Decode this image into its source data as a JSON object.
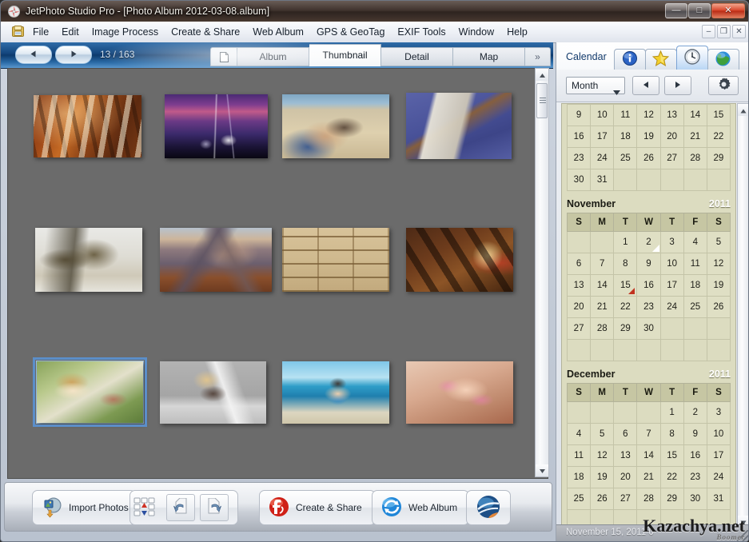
{
  "window": {
    "title": "JetPhoto Studio Pro - [Photo Album 2012-03-08.album]",
    "app_icon": "jetphoto-logo-icon",
    "minimize_label": "—",
    "maximize_label": "□",
    "close_label": "✕"
  },
  "menubar": {
    "doc_icon": "album-document-icon",
    "items": [
      {
        "label": "File"
      },
      {
        "label": "Edit"
      },
      {
        "label": "Image Process"
      },
      {
        "label": "Create & Share"
      },
      {
        "label": "Web Album"
      },
      {
        "label": "GPS & GeoTag"
      },
      {
        "label": "EXIF Tools"
      },
      {
        "label": "Window"
      },
      {
        "label": "Help"
      }
    ],
    "mdi": {
      "minimize": "–",
      "restore": "❐",
      "close": "✕"
    }
  },
  "toolbar": {
    "prev_icon": "triangle-left-icon",
    "next_icon": "triangle-right-icon",
    "counter": "13 / 163",
    "page_icon": "page-icon",
    "tabs": [
      {
        "label": "Album",
        "active": false
      },
      {
        "label": "Thumbnail",
        "active": true
      },
      {
        "label": "Detail",
        "active": false
      },
      {
        "label": "Map",
        "active": false
      }
    ],
    "more_label": "»"
  },
  "photo_grid": {
    "scrollbar": {
      "up_icon": "triangle-up-icon",
      "down_icon": "triangle-down-icon"
    },
    "thumbnails": [
      {
        "name": "wine-bottles",
        "style": "ph-wine",
        "selected": false
      },
      {
        "name": "lightning-storm",
        "style": "ph-storm",
        "selected": false
      },
      {
        "name": "woman-on-beach",
        "style": "ph-beach",
        "selected": false
      },
      {
        "name": "pistol-on-cloth",
        "style": "ph-gun",
        "selected": false
      },
      {
        "name": "soldiers-with-rifle",
        "style": "ph-soldier",
        "selected": false
      },
      {
        "name": "mountain-range",
        "style": "ph-mountain",
        "selected": false
      },
      {
        "name": "wine-corks",
        "style": "ph-cork",
        "selected": false
      },
      {
        "name": "cigars-and-pocket-watch",
        "style": "ph-cigar",
        "selected": false
      },
      {
        "name": "blonde-woman-in-garden",
        "style": "ph-blonde-garden",
        "selected": true
      },
      {
        "name": "blonde-woman-in-boots",
        "style": "ph-blonde-boots",
        "selected": false
      },
      {
        "name": "woman-in-blue-swimsuit",
        "style": "ph-sea",
        "selected": false
      },
      {
        "name": "woman-in-pink-bikini",
        "style": "ph-pink",
        "selected": false
      }
    ]
  },
  "bottom_toolbar": {
    "import_photos": {
      "label": "Import Photos",
      "icon": "import-photos-icon"
    },
    "sort_icon": "sort-updown-icon",
    "undo_icon": "undo-arrow-icon",
    "redo_icon": "redo-arrow-icon",
    "create_share": {
      "label": "Create & Share",
      "icon": "flash-ball-icon"
    },
    "web_album": {
      "label": "Web Album",
      "icon": "web-globe-icon"
    },
    "geotag": {
      "label": "",
      "icon": "geotag-globe-icon"
    }
  },
  "right_panel": {
    "tab_label": "Calendar",
    "tabs": [
      {
        "name": "info-tab",
        "icon": "info-circle-icon",
        "active": false
      },
      {
        "name": "rating-tab",
        "icon": "star-icon",
        "active": false
      },
      {
        "name": "calendar-tab",
        "icon": "clock-icon",
        "active": true
      },
      {
        "name": "map-tab",
        "icon": "globe-icon",
        "active": false
      }
    ],
    "controls": {
      "view_mode": "Month",
      "dropdown_icon": "chevron-down-icon",
      "prev_icon": "triangle-left-icon",
      "next_icon": "triangle-right-icon",
      "settings_icon": "gear-icon"
    },
    "calendar": {
      "weekday_headers": [
        "S",
        "M",
        "T",
        "W",
        "T",
        "F",
        "S"
      ],
      "months": [
        {
          "name": "",
          "year": "",
          "partial": true,
          "weeks": [
            [
              "9",
              "10",
              "11",
              "12",
              "13",
              "14",
              "15"
            ],
            [
              "16",
              "17",
              "18",
              "19",
              "20",
              "21",
              "22"
            ],
            [
              "23",
              "24",
              "25",
              "26",
              "27",
              "28",
              "29"
            ],
            [
              "30",
              "31",
              "",
              "",
              "",
              "",
              ""
            ]
          ]
        },
        {
          "name": "November",
          "year": "2011",
          "partial": false,
          "weeks": [
            [
              "",
              "",
              "1",
              "2",
              "3",
              "4",
              "5"
            ],
            [
              "6",
              "7",
              "8",
              "9",
              "10",
              "11",
              "12"
            ],
            [
              "13",
              "14",
              "15",
              "16",
              "17",
              "18",
              "19"
            ],
            [
              "20",
              "21",
              "22",
              "23",
              "24",
              "25",
              "26"
            ],
            [
              "27",
              "28",
              "29",
              "30",
              "",
              "",
              ""
            ],
            [
              "",
              "",
              "",
              "",
              "",
              "",
              ""
            ]
          ],
          "markers": [
            {
              "day": "2",
              "type": "white"
            },
            {
              "day": "15",
              "type": "red"
            }
          ]
        },
        {
          "name": "December",
          "year": "2011",
          "partial": false,
          "weeks": [
            [
              "",
              "",
              "",
              "",
              "1",
              "2",
              "3"
            ],
            [
              "4",
              "5",
              "6",
              "7",
              "8",
              "9",
              "10"
            ],
            [
              "11",
              "12",
              "13",
              "14",
              "15",
              "16",
              "17"
            ],
            [
              "18",
              "19",
              "20",
              "21",
              "22",
              "23",
              "24"
            ],
            [
              "25",
              "26",
              "27",
              "28",
              "29",
              "30",
              "31"
            ],
            [
              "",
              "",
              "",
              "",
              "",
              "",
              ""
            ]
          ],
          "markers": []
        }
      ],
      "scrollbar": {
        "up_icon": "triangle-up-icon",
        "down_icon": "triangle-down-icon"
      }
    },
    "statusbar": {
      "text": "November 15, 2011 0"
    },
    "watermark": {
      "text": "Kazachya.net",
      "sub": "Boomer"
    }
  },
  "colors": {
    "accent_blue": "#14477f",
    "selection_blue": "#5b8ec9",
    "calendar_bg": "#dcdcc0",
    "calendar_header": "#c6c6a3",
    "marker_red": "#c1321f",
    "grid_bg": "#6b6b6b",
    "close_red": "#d8452a"
  }
}
